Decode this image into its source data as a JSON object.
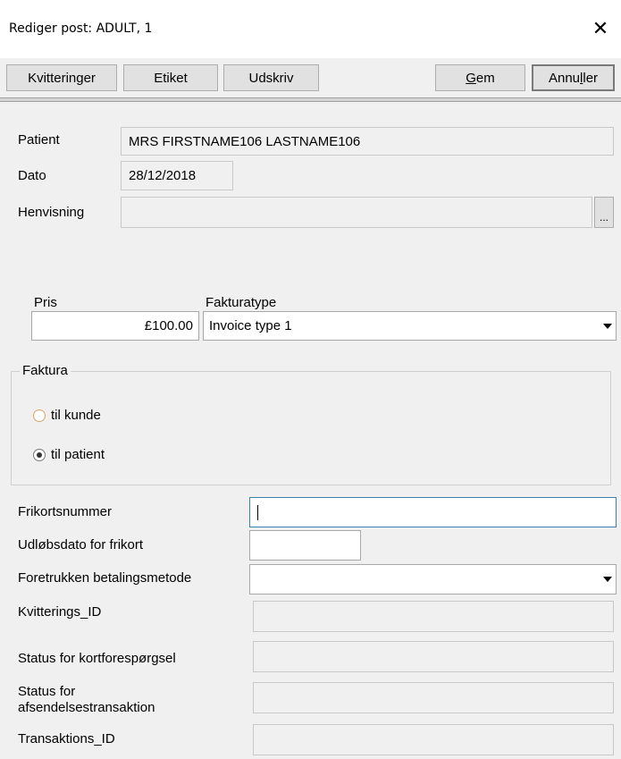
{
  "window": {
    "title": "Rediger post: ADULT, 1",
    "close_symbol": "✕"
  },
  "toolbar": {
    "receipts_label": "Kvitteringer",
    "label_label": "Etiket",
    "print_label": "Udskriv",
    "save_label_pre": "",
    "save_label_acc": "G",
    "save_label_post": "em",
    "cancel_label_pre": "Annu",
    "cancel_label_acc": "l",
    "cancel_label_post": "ler"
  },
  "patient_info": {
    "patient_label": "Patient",
    "patient_value": "MRS FIRSTNAME106 LASTNAME106",
    "date_label": "Dato",
    "date_value": "28/12/2018",
    "referral_label": "Henvisning",
    "referral_value": "",
    "referral_button": "..."
  },
  "pricing": {
    "price_label": "Pris",
    "price_value": "£100.00",
    "invoice_type_label": "Fakturatype",
    "invoice_type_value": "Invoice type 1"
  },
  "invoice_group": {
    "title": "Faktura",
    "options": [
      {
        "label": "til kunde",
        "checked": false
      },
      {
        "label": "til patient",
        "checked": true
      }
    ]
  },
  "payment": {
    "exemption_number_label": "Frikortsnummer",
    "exemption_number_value": "",
    "exemption_expiry_label": "Udløbsdato for frikort",
    "exemption_expiry_value": "",
    "preferred_method_label": "Foretrukken betalingsmetode",
    "preferred_method_value": "",
    "receipt_id_label": "Kvitterings_ID",
    "receipt_id_value": "",
    "card_status_label": "Status for kortforespørgsel",
    "card_status_value": "",
    "send_status_label_line1": "Status for",
    "send_status_label_line2": "afsendelsestransaktion",
    "send_status_value": "",
    "transaction_id_label": "Transaktions_ID",
    "transaction_id_value": ""
  },
  "colors": {
    "window_bg": "#f0f0f0",
    "focus_border": "#3c7fb1",
    "radio_unchecked_border": "#d9a56a"
  }
}
